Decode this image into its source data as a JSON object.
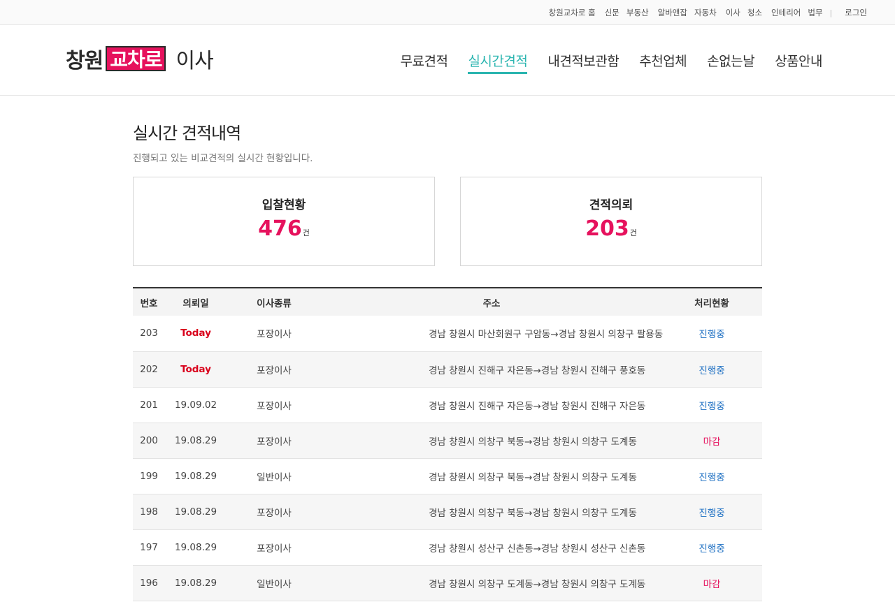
{
  "topbar": {
    "links": [
      "창원교차로 홈",
      "신문",
      "부동산",
      "알바앤잡",
      "자동차",
      "이사",
      "청소",
      "인테리어",
      "법무"
    ],
    "separator": "|",
    "login": "로그인"
  },
  "header": {
    "logo": {
      "prefix": "창원",
      "highlight": "교차로",
      "suffix": "이사",
      "highlight_color": "#e6125d"
    },
    "nav": [
      {
        "label": "무료견적",
        "active": false
      },
      {
        "label": "실시간견적",
        "active": true
      },
      {
        "label": "내견적보관함",
        "active": false
      },
      {
        "label": "추천업체",
        "active": false
      },
      {
        "label": "손없는날",
        "active": false
      },
      {
        "label": "상품안내",
        "active": false
      }
    ],
    "active_color": "#2bb5b0"
  },
  "main": {
    "title": "실시간 견적내역",
    "description": "진행되고 있는 비교견적의 실시간 현황입니다.",
    "stats": [
      {
        "label": "입찰현황",
        "value": "476",
        "unit": "건"
      },
      {
        "label": "견적의뢰",
        "value": "203",
        "unit": "건"
      }
    ],
    "table": {
      "headers": [
        "번호",
        "의뢰일",
        "이사종류",
        "주소",
        "처리현황"
      ],
      "rows": [
        {
          "no": "203",
          "date": "Today",
          "type": "포장이사",
          "address": "경남 창원시 마산회원구 구암동→경남 창원시 의창구 팔용동",
          "status": "진행중"
        },
        {
          "no": "202",
          "date": "Today",
          "type": "포장이사",
          "address": "경남 창원시 진해구 자은동→경남 창원시 진해구 풍호동",
          "status": "진행중"
        },
        {
          "no": "201",
          "date": "19.09.02",
          "type": "포장이사",
          "address": "경남 창원시 진해구 자은동→경남 창원시 진해구 자은동",
          "status": "진행중"
        },
        {
          "no": "200",
          "date": "19.08.29",
          "type": "포장이사",
          "address": "경남 창원시 의창구 북동→경남 창원시 의창구 도계동",
          "status": "마감"
        },
        {
          "no": "199",
          "date": "19.08.29",
          "type": "일반이사",
          "address": "경남 창원시 의창구 북동→경남 창원시 의창구 도계동",
          "status": "진행중"
        },
        {
          "no": "198",
          "date": "19.08.29",
          "type": "포장이사",
          "address": "경남 창원시 의창구 북동→경남 창원시 의창구 도계동",
          "status": "진행중"
        },
        {
          "no": "197",
          "date": "19.08.29",
          "type": "포장이사",
          "address": "경남 창원시 성산구 신촌동→경남 창원시 성산구 신촌동",
          "status": "진행중"
        },
        {
          "no": "196",
          "date": "19.08.29",
          "type": "일반이사",
          "address": "경남 창원시 의창구 도계동→경남 창원시 의창구 도계동",
          "status": "마감"
        }
      ]
    },
    "colors": {
      "accent": "#e6125d",
      "today": "#d9001b",
      "in_progress": "#1b6ec2",
      "closed": "#e6125d"
    }
  }
}
